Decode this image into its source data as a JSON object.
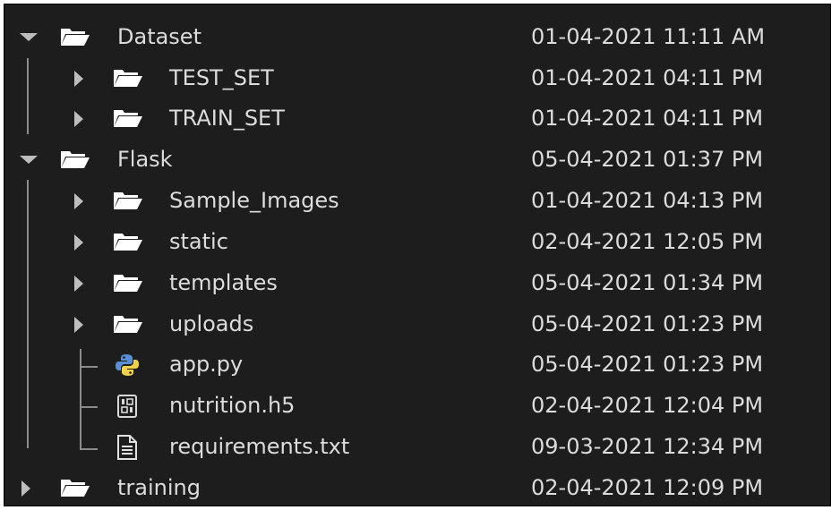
{
  "explorer": {
    "rows": [
      {
        "name": "Dataset",
        "modified": "01-04-2021 11:11 AM"
      },
      {
        "name": "TEST_SET",
        "modified": "01-04-2021 04:11 PM"
      },
      {
        "name": "TRAIN_SET",
        "modified": "01-04-2021 04:11 PM"
      },
      {
        "name": "Flask",
        "modified": "05-04-2021 01:37 PM"
      },
      {
        "name": "Sample_Images",
        "modified": "01-04-2021 04:13 PM"
      },
      {
        "name": "static",
        "modified": "02-04-2021 12:05 PM"
      },
      {
        "name": "templates",
        "modified": "05-04-2021 01:34 PM"
      },
      {
        "name": "uploads",
        "modified": "05-04-2021 01:23 PM"
      },
      {
        "name": "app.py",
        "modified": "05-04-2021 01:23 PM"
      },
      {
        "name": "nutrition.h5",
        "modified": "02-04-2021 12:04 PM"
      },
      {
        "name": "requirements.txt",
        "modified": "09-03-2021 12:34 PM"
      },
      {
        "name": "training",
        "modified": "02-04-2021 12:09 PM"
      }
    ]
  },
  "colors": {
    "background": "#1d1d1d",
    "text": "#dcdcdc",
    "folder_icon": "#ffffff",
    "python_blue": "#5a8fd8",
    "python_yellow": "#f2d24b"
  }
}
